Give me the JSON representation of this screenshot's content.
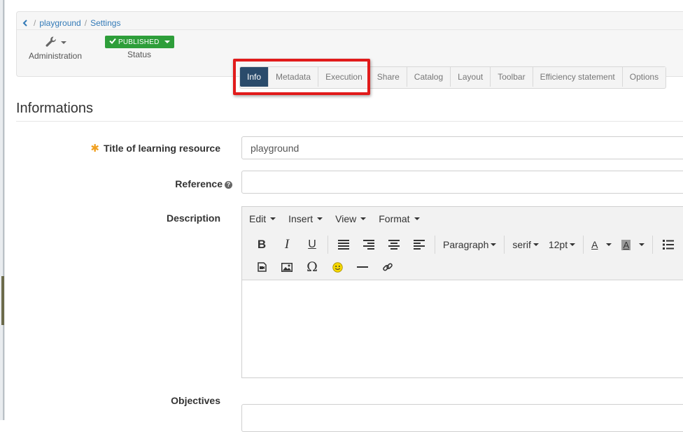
{
  "breadcrumb": {
    "items": [
      "playground",
      "Settings"
    ]
  },
  "tools": {
    "administration_label": "Administration",
    "status_badge": "PUBLISHED",
    "status_label": "Status"
  },
  "tabs": [
    "Info",
    "Metadata",
    "Execution",
    "Share",
    "Catalog",
    "Layout",
    "Toolbar",
    "Efficiency statement",
    "Options"
  ],
  "active_tab": "Info",
  "section": {
    "title": "Informations"
  },
  "form": {
    "title_label": "Title of learning resource",
    "title_value": "playground",
    "reference_label": "Reference",
    "reference_value": "",
    "description_label": "Description",
    "objectives_label": "Objectives"
  },
  "editor": {
    "menus": [
      "Edit",
      "Insert",
      "View",
      "Format"
    ],
    "block_format": "Paragraph",
    "font_family": "serif",
    "font_size": "12pt",
    "bold": "B",
    "italic": "I",
    "underline": "U",
    "text_color": "A",
    "bg_color": "A",
    "special_char": "Ω"
  },
  "colors": {
    "active_tab": "#2a4b6b",
    "published": "#2e9e3a",
    "highlight": "#e11b1b",
    "required_star": "#f0a020",
    "link": "#337ab7"
  }
}
